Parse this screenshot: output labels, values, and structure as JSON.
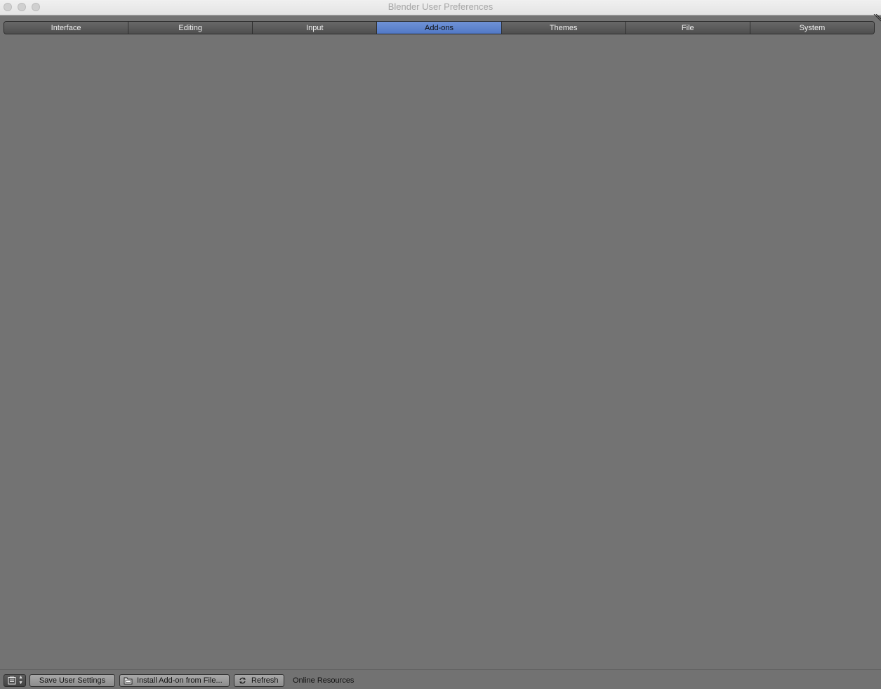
{
  "window": {
    "title": "Blender User Preferences"
  },
  "tabs": [
    {
      "label": "Interface",
      "active": false
    },
    {
      "label": "Editing",
      "active": false
    },
    {
      "label": "Input",
      "active": false
    },
    {
      "label": "Add-ons",
      "active": true
    },
    {
      "label": "Themes",
      "active": false
    },
    {
      "label": "File",
      "active": false
    },
    {
      "label": "System",
      "active": false
    }
  ],
  "bottom_bar": {
    "editor_type_icon": "preferences-icon",
    "save_label": "Save User Settings",
    "install_label": "Install Add-on from File...",
    "install_icon": "folder-icon",
    "refresh_label": "Refresh",
    "refresh_icon": "refresh-icon",
    "online_resources_label": "Online Resources"
  },
  "colors": {
    "active_tab": "#5279c6",
    "background": "#737373"
  }
}
